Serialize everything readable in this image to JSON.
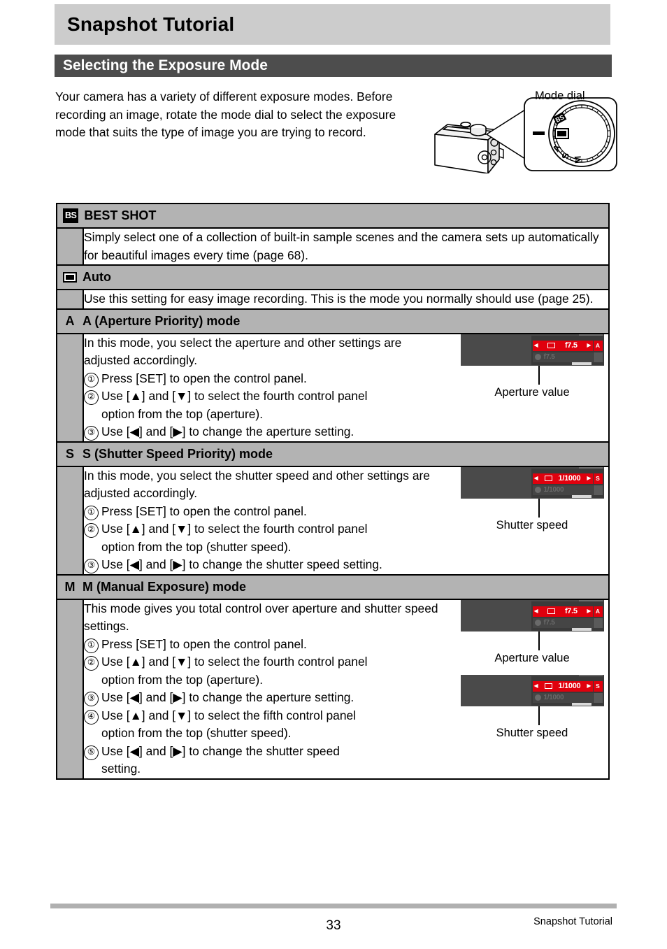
{
  "page": {
    "title": "Snapshot Tutorial",
    "section_heading": "Selecting the Exposure Mode",
    "intro": "Your camera has a variety of different exposure modes. Before recording an image, rotate the mode dial to select the exposure mode that suits the type of image you are trying to record."
  },
  "figure": {
    "dial_caption": "Mode dial",
    "dial_labels": [
      "BS",
      "A",
      "S",
      "M"
    ]
  },
  "table": {
    "rows": [
      {
        "icon": "bs-badge-icon",
        "icon_text": "BS",
        "title": "BEST SHOT",
        "body_paragraph": "Simply select one of a collection of built-in sample scenes and the camera sets up automatically for beautiful images every time (page 68).",
        "steps": [],
        "figures": []
      },
      {
        "icon": "auto-rectangle-icon",
        "icon_text": "",
        "title": "Auto",
        "body_paragraph": "Use this setting for easy image recording. This is the mode you normally should use (page 25).",
        "steps": [],
        "figures": []
      },
      {
        "icon": "letter-a-icon",
        "icon_text": "A",
        "title": "A (Aperture Priority) mode",
        "body_paragraph": "In this mode, you select the aperture and other settings are adjusted accordingly.",
        "steps": [
          {
            "num": "①",
            "text": "Press [SET] to open the control panel.",
            "indent": ""
          },
          {
            "num": "②",
            "text": "Use [▲] and [▼] to select the fourth control panel",
            "indent": "option from the top (aperture)."
          },
          {
            "num": "③",
            "text": "Use [◀] and [▶] to change the aperture setting.",
            "indent": ""
          }
        ],
        "figures": [
          {
            "value": "f7.5",
            "dim_value": "f7.5",
            "badge": "A",
            "caption": "Aperture value"
          }
        ]
      },
      {
        "icon": "letter-s-icon",
        "icon_text": "S",
        "title": "S (Shutter Speed Priority) mode",
        "body_paragraph": "In this mode, you select the shutter speed and other settings are adjusted accordingly.",
        "steps": [
          {
            "num": "①",
            "text": "Press [SET] to open the control panel.",
            "indent": ""
          },
          {
            "num": "②",
            "text": "Use [▲] and [▼] to select the fourth control panel",
            "indent": "option from the top (shutter speed)."
          },
          {
            "num": "③",
            "text": "Use [◀] and [▶] to change the shutter speed setting.",
            "indent": ""
          }
        ],
        "figures": [
          {
            "value": "1/1000",
            "dim_value": "1/1000",
            "badge": "S",
            "caption": "Shutter speed"
          }
        ]
      },
      {
        "icon": "letter-m-icon",
        "icon_text": "M",
        "title": "M (Manual Exposure) mode",
        "body_paragraph": "This mode gives you total control over aperture and shutter speed settings.",
        "steps": [
          {
            "num": "①",
            "text": "Press [SET] to open the control panel.",
            "indent": ""
          },
          {
            "num": "②",
            "text": "Use [▲] and [▼] to select the fourth control panel",
            "indent": "option from the top (aperture)."
          },
          {
            "num": "③",
            "text": "Use [◀] and [▶] to change the aperture setting.",
            "indent": ""
          },
          {
            "num": "④",
            "text": "Use [▲] and [▼] to select the fifth control panel",
            "indent": "option from the top (shutter speed)."
          },
          {
            "num": "⑤",
            "text": "Use [◀] and [▶] to change the shutter speed",
            "indent": "setting."
          }
        ],
        "figures": [
          {
            "value": "f7.5",
            "dim_value": "f7.5",
            "badge": "A",
            "caption": "Aperture value"
          },
          {
            "value": "1/1000",
            "dim_value": "1/1000",
            "badge": "S",
            "caption": "Shutter speed"
          }
        ]
      }
    ]
  },
  "footer": {
    "page_number": "33",
    "section_label": "Snapshot Tutorial"
  },
  "colors": {
    "title_band": "#cccccc",
    "section_band": "#4d4d4d",
    "table_header": "#b3b3b3",
    "lcd_highlight": "#e0000d",
    "lcd_body": "#4a4a4a"
  }
}
